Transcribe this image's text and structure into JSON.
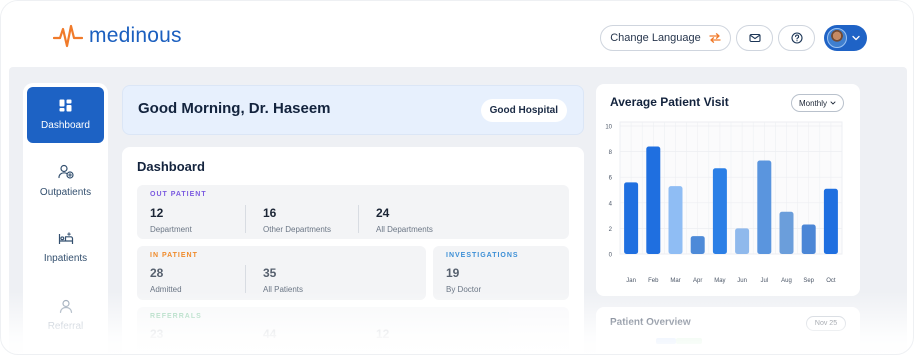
{
  "header": {
    "logo_text": "medinous",
    "change_language_label": "Change Language",
    "icons": [
      "swap-icon",
      "mail-icon",
      "help-icon",
      "chevron-down-icon"
    ],
    "brand_color": "#1f63c6",
    "accent_color": "#f07a2a"
  },
  "sidebar": {
    "items": [
      {
        "label": "Dashboard",
        "icon": "grid-icon",
        "active": true
      },
      {
        "label": "Outpatients",
        "icon": "user-plus-icon"
      },
      {
        "label": "Inpatients",
        "icon": "bed-icon"
      },
      {
        "label": "Referral",
        "icon": "user-icon"
      }
    ]
  },
  "greeting": {
    "title": "Good Morning, Dr. Haseem",
    "hospital": "Good Hospital"
  },
  "dashboard": {
    "title": "Dashboard",
    "out_patient": {
      "label": "OUT PATIENT",
      "color": "#7b5be0",
      "stats": [
        {
          "value": "12",
          "label": "Department"
        },
        {
          "value": "16",
          "label": "Other Departments"
        },
        {
          "value": "24",
          "label": "All Departments"
        }
      ]
    },
    "in_patient": {
      "label": "IN PATIENT",
      "color": "#f08a2a",
      "stats": [
        {
          "value": "28",
          "label": "Admitted"
        },
        {
          "value": "35",
          "label": "All Patients"
        }
      ]
    },
    "investigations": {
      "label": "INVESTIGATIONS",
      "color": "#3c8fd6",
      "stats": [
        {
          "value": "19",
          "label": "By Doctor"
        }
      ]
    },
    "referrals": {
      "label": "REFERRALS",
      "color": "#3aa86b",
      "stats": [
        {
          "value": "23",
          "label": ""
        },
        {
          "value": "44",
          "label": ""
        },
        {
          "value": "12",
          "label": ""
        }
      ]
    }
  },
  "patient_visit": {
    "title": "Average Patient Visit",
    "period": "Monthly"
  },
  "patient_overview": {
    "title": "Patient Overview",
    "period": "Nov 25"
  },
  "chart_data": {
    "type": "bar",
    "title": "Average Patient Visit",
    "categories": [
      "Jan",
      "Feb",
      "Mar",
      "Apr",
      "May",
      "Jun",
      "Jul",
      "Aug",
      "Sep",
      "Oct"
    ],
    "values": [
      5.6,
      8.4,
      5.3,
      1.4,
      6.7,
      2.0,
      7.3,
      3.3,
      2.3,
      5.1
    ],
    "yticks": [
      0,
      2,
      4,
      6,
      8,
      10
    ],
    "ylim": [
      0,
      10
    ],
    "xlabel": "",
    "ylabel": "",
    "grid": true,
    "bar_colors": [
      "#1f6fe0",
      "#1f6fe0",
      "#8fbdf4",
      "#4d8ad8",
      "#2b7fe6",
      "#8fb9ec",
      "#5a95de",
      "#6b9edb",
      "#4b86d6",
      "#1f6fe0"
    ]
  }
}
